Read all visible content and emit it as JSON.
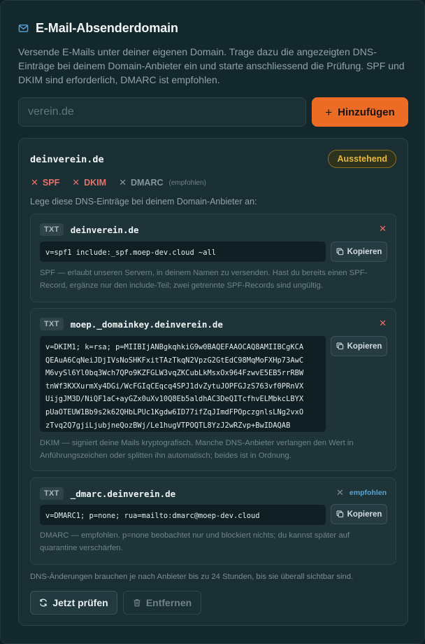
{
  "header": {
    "title": "E-Mail-Absenderdomain",
    "description": "Versende E-Mails unter deiner eigenen Domain. Trage dazu die angezeigten DNS-Einträge bei deinem Domain-Anbieter ein und starte anschliessend die Prüfung. SPF und DKIM sind erforderlich, DMARC ist empfohlen."
  },
  "add_form": {
    "placeholder": "verein.de",
    "value": "",
    "button_label": "Hinzufügen"
  },
  "domain": {
    "name": "deinverein.de",
    "status": "Ausstehend",
    "checks": [
      {
        "label": "SPF",
        "state": "fail"
      },
      {
        "label": "DKIM",
        "state": "fail"
      },
      {
        "label": "DMARC",
        "state": "neutral",
        "optional_label": "(empfohlen)"
      }
    ],
    "hint": "Lege diese DNS-Einträge bei deinem Domain-Anbieter an:",
    "records": [
      {
        "type": "TXT",
        "name": "deinverein.de",
        "value": "v=spf1 include:_spf.moep-dev.cloud ~all",
        "copy_label": "Kopieren",
        "note": "SPF — erlaubt unseren Servern, in deinem Namen zu versenden. Hast du bereits einen SPF-Record, ergänze nur den include-Teil; zwei getrennte SPF-Records sind ungültig."
      },
      {
        "type": "TXT",
        "name": "moep._domainkey.deinverein.de",
        "value": "v=DKIM1; k=rsa; p=MIIBIjANBgkqhkiG9w0BAQEFAAOCAQ8AMIIBCgKCA\nQEAuA6CqNeiJDjIVsNoSHKFxitTAzTkqN2VpzG2GtEdC98MqMoFXHp73AwC\nM6vySl6Yl0bq3Wch7QPo9KZFGLW3vqZKCubLkMsxOx964FzwvE5EB5rrRBW\ntnWf3KXXurmXy4DGi/WcFGIqCEqcq4SPJ1dvZytuJOPFGJzS763vf0PRnVX\nUijgJM3D/NiQF1aC+ayGZx0uXv10Q8Eb5aldhAC3DeQITcfhvELMbkcLBYX\npUaOTEUW1Bb9s2k62QHbLPUc1Kgdw6ID77ifZqJImdFPOpczgnlsLNg2vxO\nzTvq2Q7gjiLjubjneQozBWj/Le1hugVTPOQTL8YzJ2wRZvp+BwIDAQAB",
        "copy_label": "Kopieren",
        "note": "DKIM — signiert deine Mails kryptografisch. Manche DNS-Anbieter verlangen den Wert in Anführungszeichen oder splitten ihn automatisch; beides ist in Ordnung."
      },
      {
        "type": "TXT",
        "name": "_dmarc.deinverein.de",
        "value": "v=DMARC1; p=none; rua=mailto:dmarc@moep-dev.cloud",
        "copy_label": "Kopieren",
        "optional_label": "empfohlen",
        "note": "DMARC — empfohlen. p=none beobachtet nur und blockiert nichts; du kannst später auf quarantine verschärfen."
      }
    ],
    "footer_note": "DNS-Änderungen brauchen je nach Anbieter bis zu 24 Stunden, bis sie überall sichtbar sind.",
    "check_button": "Jetzt prüfen",
    "remove_button": "Entfernen"
  },
  "colors": {
    "accent": "#ec6c26",
    "pending": "#e9b83a",
    "fail": "#e7716b",
    "info": "#5aa3d8"
  }
}
